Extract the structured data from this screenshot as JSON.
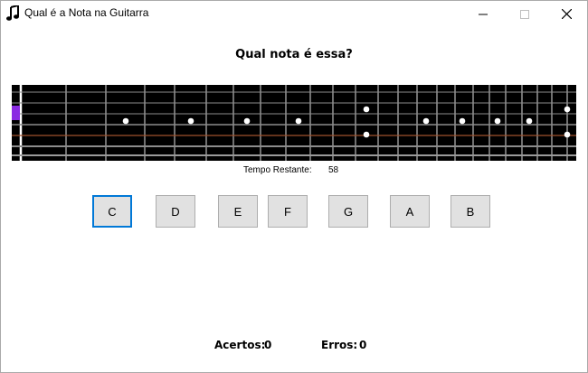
{
  "window": {
    "title": "Qual é a Nota na Guitarra",
    "icon": "music-note-icon"
  },
  "game": {
    "question": "Qual nota é essa?",
    "time_label": "Tempo Restante:",
    "time_value": "58",
    "notes": [
      "C",
      "D",
      "E",
      "F",
      "G",
      "A",
      "B"
    ],
    "score": {
      "hits_label": "Acertos:",
      "hits_value": "0",
      "errors_label": "Erros:",
      "errors_value": "0"
    }
  },
  "colors": {
    "fretboard": "#000000",
    "string": "#c8c8c8",
    "fret": "#ffffff",
    "highlight_string": "#a0522d",
    "marker": "#ffffff",
    "current_position": "#8a2be2",
    "focus": "#0078d7"
  }
}
